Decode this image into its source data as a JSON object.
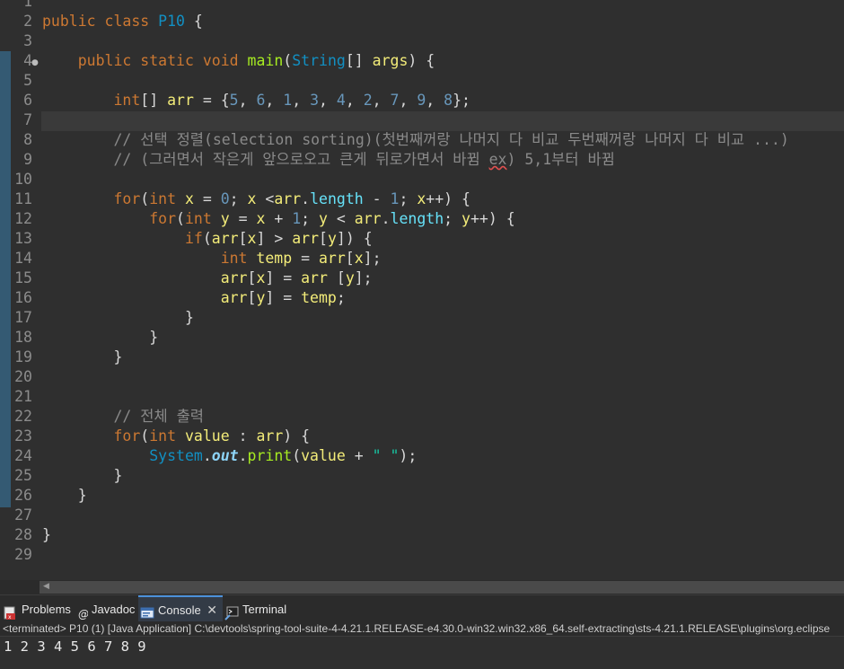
{
  "editor": {
    "line_numbers": [
      "1",
      "2",
      "3",
      "4",
      "5",
      "6",
      "7",
      "8",
      "9",
      "10",
      "11",
      "12",
      "13",
      "14",
      "15",
      "16",
      "17",
      "18",
      "19",
      "20",
      "21",
      "22",
      "23",
      "24",
      "25",
      "26",
      "27",
      "28",
      "29"
    ],
    "line2": {
      "kw1": "public",
      "kw2": "class",
      "cls": "P10",
      "rest": " {"
    },
    "line4": {
      "kw1": "public",
      "kw2": "static",
      "kw3": "void",
      "fn": "main",
      "p1": "(",
      "cls": "String",
      "p2": "[] ",
      "var": "args",
      "rest": ") {"
    },
    "line6": {
      "kw": "int",
      "p1": "[] ",
      "var": "arr",
      "p2": " = {",
      "n1": "5",
      "n2": "6",
      "n3": "1",
      "n4": "3",
      "n5": "4",
      "n6": "2",
      "n7": "7",
      "n8": "9",
      "n9": "8",
      "sep": ", ",
      "end": "};"
    },
    "line8": "// 선택 정렬(selection sorting)(첫번째꺼랑 나머지 다 비교 두번째꺼랑 나머지 다 비교 ...)",
    "line9": {
      "a": "// (그러면서 작은게 앞으로오고 큰게 뒤로가면서 바뀜 ",
      "b": "ex",
      ") 5,1부터 바뀜": "",
      "c": ") 5,1부터 바뀜"
    },
    "line11": {
      "kw1": "for",
      "p1": "(",
      "kw2": "int",
      "v1": " x",
      "p2": " = ",
      "n1": "0",
      "p3": "; ",
      "v2": "x",
      "p4": " <",
      "v3": "arr",
      "p5": ".",
      "f1": "length",
      "p6": " - ",
      "n2": "1",
      "p7": "; ",
      "v4": "x",
      "p8": "++) {"
    },
    "line12": {
      "kw1": "for",
      "p1": "(",
      "kw2": "int",
      "v1": " y",
      "p2": " = ",
      "v2": "x",
      "p3": " + ",
      "n1": "1",
      "p4": "; ",
      "v3": "y",
      "p5": " < ",
      "v4": "arr",
      "p6": ".",
      "f1": "length",
      "p7": "; ",
      "v5": "y",
      "p8": "++) {"
    },
    "line13": {
      "kw": "if",
      "p1": "(",
      "v1": "arr",
      "p2": "[",
      "v2": "x",
      "p3": "] > ",
      "v3": "arr",
      "p4": "[",
      "v4": "y",
      "p5": "]) {"
    },
    "line14": {
      "kw": "int",
      "v1": " temp",
      "p1": " = ",
      "v2": "arr",
      "p2": "[",
      "v3": "x",
      "p3": "];"
    },
    "line15": {
      "v1": "arr",
      "p1": "[",
      "v2": "x",
      "p2": "] = ",
      "v3": "arr",
      "p3": " [",
      "v4": "y",
      "p4": "];"
    },
    "line16": {
      "v1": "arr",
      "p1": "[",
      "v2": "y",
      "p2": "] = ",
      "v3": "temp",
      "p3": ";"
    },
    "line17": "}",
    "line18": "}",
    "line19": "}",
    "line22": "// 전체 출력",
    "line23": {
      "kw1": "for",
      "p1": "(",
      "kw2": "int",
      "v1": " value",
      "p2": " : ",
      "v2": "arr",
      "p3": ") {"
    },
    "line24": {
      "cls": "System",
      "p1": ".",
      "sf": "out",
      "p2": ".",
      "fn": "print",
      "p3": "(",
      "v1": "value",
      "p4": " + ",
      "str": "\" \"",
      "p5": ");"
    },
    "line25": "}",
    "line26": "}",
    "line28": "}"
  },
  "panel": {
    "tabs": {
      "problems": "Problems",
      "javadoc": "Javadoc",
      "console": "Console",
      "terminal": "Terminal"
    },
    "console_header": "<terminated> P10 (1) [Java Application] C:\\devtools\\spring-tool-suite-4-4.21.1.RELEASE-e4.30.0-win32.win32.x86_64.self-extracting\\sts-4.21.1.RELEASE\\plugins\\org.eclipse",
    "console_output": "1 2 3 4 5 6 7 8 9"
  },
  "colors": {
    "background": "#2f2f2f",
    "keyword": "#cc7832",
    "class": "#1290c3",
    "method": "#a7ec21",
    "variable": "#f3ec79",
    "number": "#6897bb",
    "comment": "#8a8a8a",
    "string": "#17c6a3"
  }
}
